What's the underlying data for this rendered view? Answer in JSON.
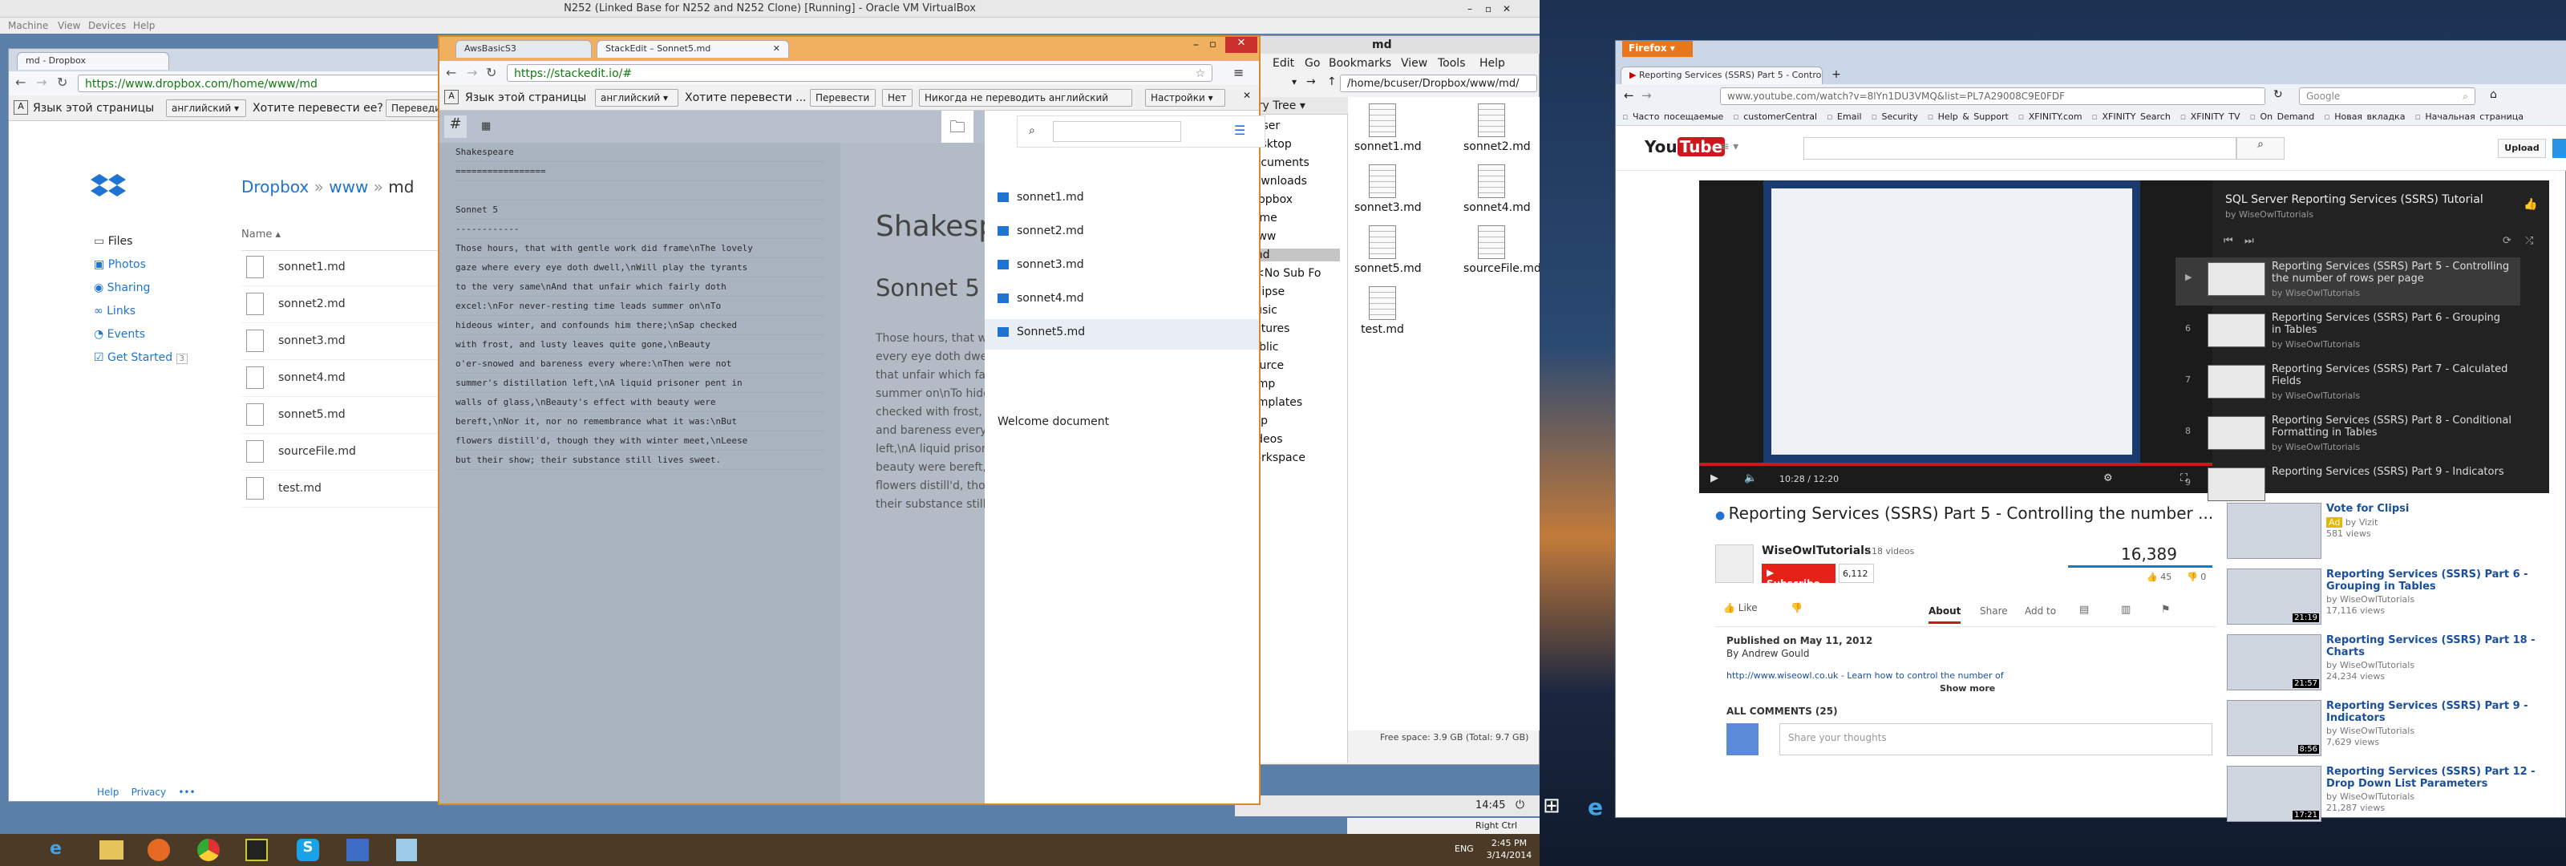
{
  "vbox": {
    "title": "N252 (Linked Base for N252 and N252 Clone) [Running] - Oracle VM VirtualBox",
    "menu": [
      "Machine",
      "View",
      "Devices",
      "Help"
    ],
    "status": "Right Ctrl"
  },
  "dropbox_browser": {
    "tab": "md - Dropbox",
    "url": "https://www.dropbox.com/home/www/md",
    "translate": {
      "prefix": "Язык этой страницы",
      "lang": "английский",
      "question": "Хотите перевести ее?",
      "translate_btn": "Переведи"
    },
    "breadcrumb": [
      "Dropbox",
      "www",
      "md"
    ],
    "nav": [
      "Files",
      "Photos",
      "Sharing",
      "Links",
      "Events",
      "Get Started"
    ],
    "get_started_badge": "3",
    "col_name": "Name",
    "files": [
      "sonnet1.md",
      "sonnet2.md",
      "sonnet3.md",
      "sonnet4.md",
      "sonnet5.md",
      "sourceFile.md",
      "test.md"
    ],
    "footer": [
      "Help",
      "Privacy",
      "•••"
    ]
  },
  "stackedit": {
    "tabs": [
      "AwsBasicS3",
      "StackEdit – Sonnet5.md"
    ],
    "url": "https://stackedit.io/#",
    "translate": {
      "prefix": "Язык этой страницы",
      "lang": "английский",
      "question": "Хотите перевести ...",
      "translate_btn": "Перевести",
      "no_btn": "Нет",
      "never_btn": "Никогда не переводить английский",
      "settings_btn": "Настройки"
    },
    "editor_lines": [
      "Shakespeare",
      "=================",
      "",
      "Sonnet 5",
      "------------",
      "Those hours, that with gentle work did frame\\nThe lovely",
      "gaze where every eye doth dwell,\\nWill play the tyrants",
      "to the very same\\nAnd that unfair which fairly doth",
      "excel:\\nFor never-resting time leads summer on\\nTo",
      "hideous winter, and confounds him there;\\nSap checked",
      "with frost, and lusty leaves quite gone,\\nBeauty",
      "o'er-snowed and bareness every where:\\nThen were not",
      "summer's distillation left,\\nA liquid prisoner pent in",
      "walls of glass,\\nBeauty's effect with beauty were",
      "bereft,\\nNor it, nor no remembrance what it was:\\nBut",
      "flowers distill'd, though they with winter meet,\\nLeese",
      "but their show; their substance still lives sweet."
    ],
    "preview_h1": "Shakesp",
    "preview_h2": "Sonnet 5",
    "preview_lines": [
      "Those hours, that wi",
      "every eye doth dwell",
      "that unfair which fair",
      "summer on\\nTo hide",
      "checked with frost, a",
      "and bareness every w",
      "left,\\nA liquid prisone",
      "beauty were bereft,\\n",
      "flowers distill'd, thou",
      "their substance still l"
    ],
    "doc_files": [
      "sonnet1.md",
      "sonnet2.md",
      "sonnet3.md",
      "sonnet4.md",
      "Sonnet5.md"
    ],
    "welcome": "Welcome document"
  },
  "filemanager": {
    "title": "md",
    "menu": [
      "Edit",
      "Go",
      "Bookmarks",
      "View",
      "Tools",
      "Help"
    ],
    "path": "/home/bcuser/Dropbox/www/md/",
    "tree_header": "ctory Tree",
    "tree": [
      "bcuser",
      "Desktop",
      "Documents",
      "Downloads",
      "Dropbox",
      "home",
      "www",
      "md",
      "<No Sub Fo",
      "Eclipse",
      "Music",
      "Pictures",
      "Public",
      "Source",
      "Temp",
      "Templates",
      "tmp",
      "Videos",
      "workspace"
    ],
    "files": [
      "sonnet1.md",
      "sonnet2.md",
      "sonnet3.md",
      "sonnet4.md",
      "sonnet5.md",
      "sourceFile.md",
      "test.md"
    ],
    "status": "Free space: 3.9 GB (Total: 9.7 GB)",
    "clock": "14:45"
  },
  "win_taskbar": {
    "lang": "ENG",
    "time": "2:45 PM",
    "date": "3/14/2014"
  },
  "firefox": {
    "brand": "Firefox",
    "tab": "Reporting Services (SSRS) Part 5 - Contro...",
    "url": "www.youtube.com/watch?v=8lYn1DU3VMQ&list=PL7A29008C9E0FDF",
    "search_engine": "Google",
    "bookmarks": [
      "Часто посещаемые",
      "customerCentral",
      "Email",
      "Security",
      "Help & Support",
      "XFINITY.com",
      "XFINITY Search",
      "XFINITY TV",
      "On Demand",
      "Новая вкладка",
      "Начальная страница"
    ]
  },
  "youtube": {
    "logo": "You",
    "logo_tube": "Tube",
    "upload": "Upload",
    "playlist_title": "SQL Server Reporting Services (SSRS) Tutorial",
    "playlist_by": "by WiseOwlTutorials",
    "playlist": [
      {
        "n": "▶",
        "title": "Reporting Services (SSRS) Part 5 - Controlling the number of rows per page",
        "by": "by WiseOwlTutorials"
      },
      {
        "n": "6",
        "title": "Reporting Services (SSRS) Part 6 - Grouping in Tables",
        "by": "by WiseOwlTutorials"
      },
      {
        "n": "7",
        "title": "Reporting Services (SSRS) Part 7 - Calculated Fields",
        "by": "by WiseOwlTutorials"
      },
      {
        "n": "8",
        "title": "Reporting Services (SSRS) Part 8 - Conditional Formatting in Tables",
        "by": "by WiseOwlTutorials"
      },
      {
        "n": "9",
        "title": "Reporting Services (SSRS) Part 9 - Indicators",
        "by": ""
      }
    ],
    "player_time": "10:28 / 12:20",
    "video_title": "Reporting Services (SSRS) Part 5 - Controlling the number ...",
    "channel": "WiseOwlTutorials",
    "channel_videos": "118 videos",
    "subscribe": "Subscribe",
    "subs": "6,112",
    "views": "16,389",
    "likes": "45",
    "dislikes": "0",
    "like": "Like",
    "tabs": [
      "About",
      "Share",
      "Add to"
    ],
    "published": "Published on May 11, 2012",
    "by_line": "By Andrew Gould",
    "desc": "http://www.wiseowl.co.uk - Learn how to control the number of",
    "show_more": "Show more",
    "comments_header": "ALL COMMENTS (25)",
    "share_thoughts": "Share your thoughts",
    "ad": {
      "title": "Vote for Clipsi",
      "badge": "Ad",
      "by": "by Vizit",
      "views": "581 views"
    },
    "related": [
      {
        "title": "Reporting Services (SSRS) Part 6 - Grouping in Tables",
        "by": "by WiseOwlTutorials",
        "views": "17,116 views",
        "dur": "21:19"
      },
      {
        "title": "Reporting Services (SSRS) Part 18 - Charts",
        "by": "by WiseOwlTutorials",
        "views": "24,234 views",
        "dur": "21:57"
      },
      {
        "title": "Reporting Services (SSRS) Part 9 - Indicators",
        "by": "by WiseOwlTutorials",
        "views": "7,629 views",
        "dur": "8:56"
      },
      {
        "title": "Reporting Services (SSRS) Part 12 - Drop Down List Parameters",
        "by": "by WiseOwlTutorials",
        "views": "21,287 views",
        "dur": "17:21"
      }
    ]
  }
}
